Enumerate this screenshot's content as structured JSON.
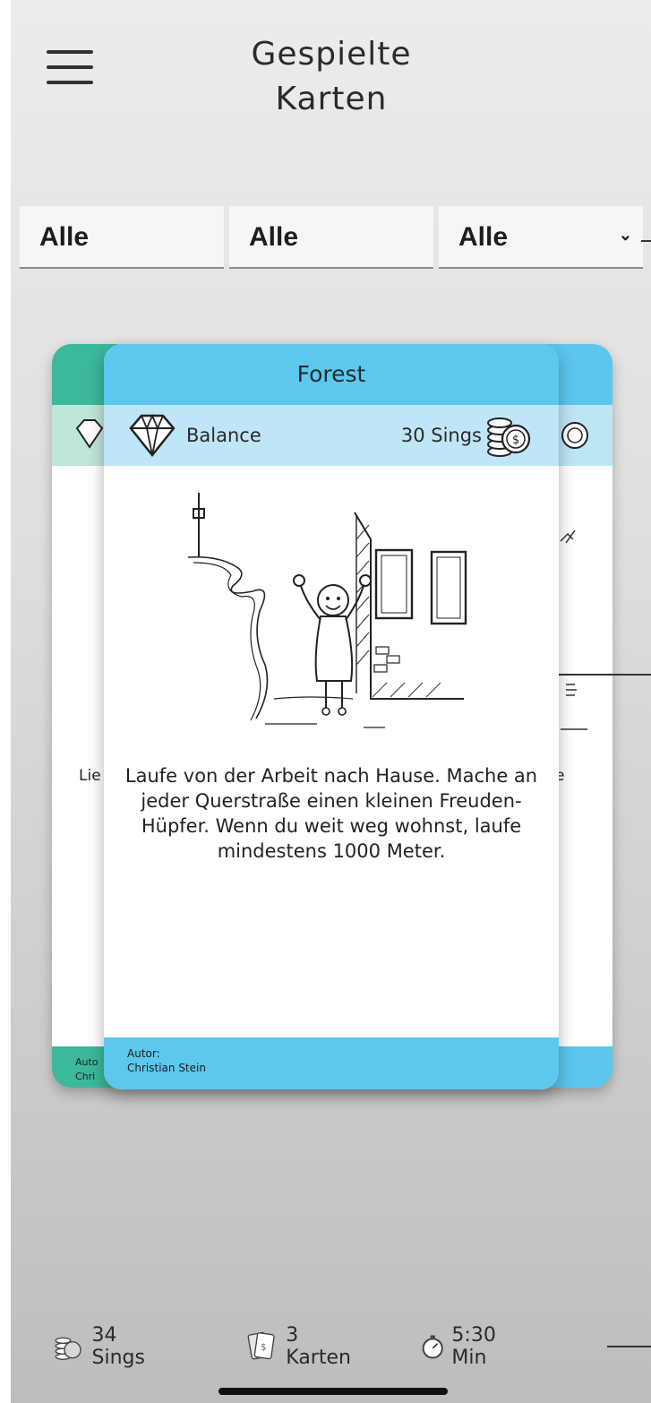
{
  "header": {
    "title_line1": "Gespielte",
    "title_line2": "Karten",
    "menu_icon": "hamburger-menu-icon"
  },
  "filters": [
    {
      "value": "Alle"
    },
    {
      "value": "Alle"
    },
    {
      "value": "Alle",
      "dropdown_icon": "chevron-down-icon"
    }
  ],
  "back_card": {
    "text_fragment": "Lie",
    "author_fragment_1": "Auto",
    "author_fragment_2": "Chri"
  },
  "card": {
    "title": "Forest",
    "category": "Balance",
    "category_icon": "diamond-icon",
    "cost": "30 Sings",
    "cost_icon": "coins-icon",
    "illustration": "person-walking-home-sketch",
    "description": "Laufe von der Arbeit nach Hause. Mache an jeder Querstraße einen kleinen Freuden-Hüpfer. Wenn du weit weg wohnst, laufe mindestens 1000 Meter.",
    "author_label": "Autor:",
    "author_name": "Christian Stein",
    "colors": {
      "header": "#5cc8ee",
      "band": "#bfe6f6",
      "back_card": "#3cb89a"
    }
  },
  "stats": {
    "sings": "34 Sings",
    "cards": "3 Karten",
    "time": "5:30 Min"
  }
}
